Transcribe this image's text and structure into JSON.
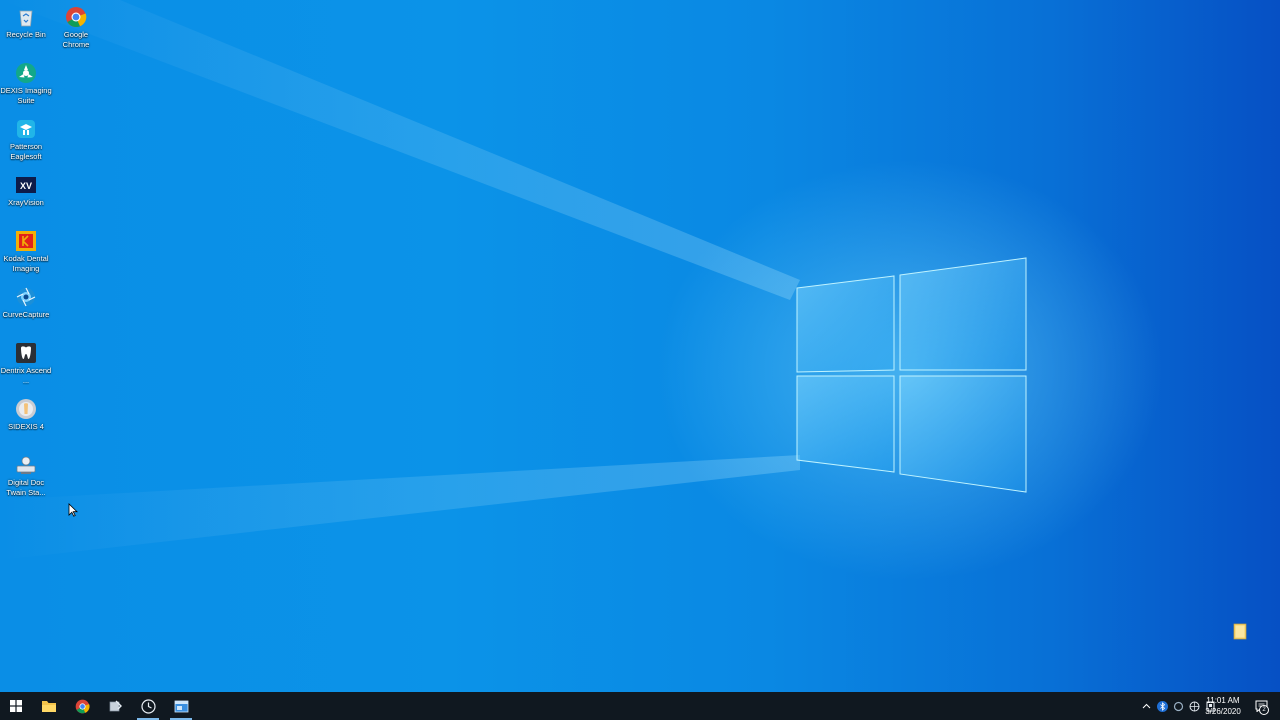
{
  "desktop_icons": [
    {
      "label": "Recycle Bin",
      "icon": "recycle-bin-icon"
    },
    {
      "label": "Google Chrome",
      "icon": "chrome-icon"
    },
    {
      "label": "DEXIS Imaging Suite",
      "icon": "dexis-icon"
    },
    {
      "label": "Patterson Eaglesoft",
      "icon": "eaglesoft-icon"
    },
    {
      "label": "XrayVision",
      "icon": "xrayvision-icon"
    },
    {
      "label": "Kodak Dental Imaging",
      "icon": "kodak-icon"
    },
    {
      "label": "CurveCapture",
      "icon": "curvecapture-icon"
    },
    {
      "label": "Dentrix Ascend ...",
      "icon": "dentrix-icon"
    },
    {
      "label": "SIDEXIS 4",
      "icon": "sidexis-icon"
    },
    {
      "label": "Digital Doc Twain Sta...",
      "icon": "digital-doc-icon"
    }
  ],
  "taskbar": {
    "pinned": [
      "start-icon",
      "file-explorer-icon",
      "chrome-icon",
      "app-icon",
      "clock-app-icon",
      "window-app-icon"
    ],
    "clock_time": "11:01 AM",
    "clock_date": "3/26/2020",
    "notification_count": "2"
  },
  "colors": {
    "wallpaper_blue": "#0a8ee6",
    "taskbar": "#101820"
  }
}
